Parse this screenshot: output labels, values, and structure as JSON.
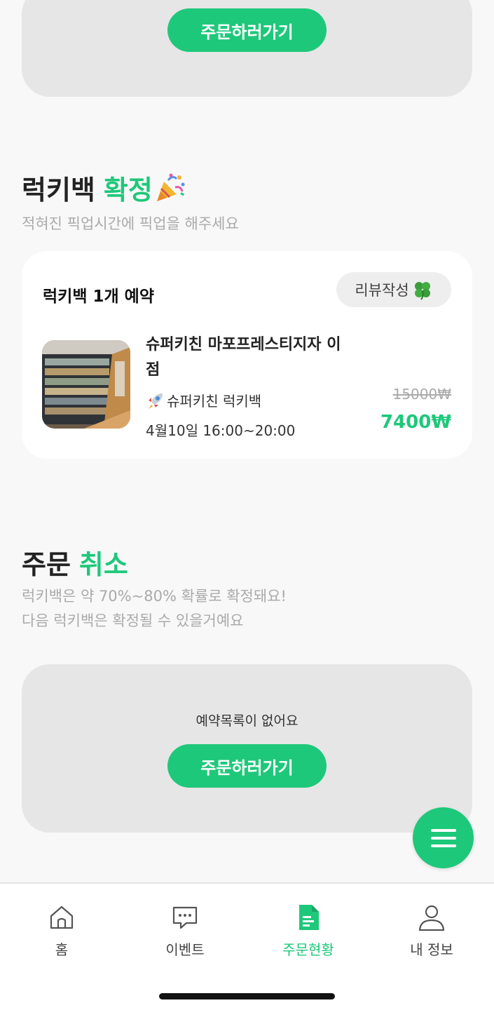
{
  "top_empty": {
    "button_label": "주문하러가기"
  },
  "confirmed": {
    "title_main": "럭키백",
    "title_accent": "확정",
    "subtitle": "적혀진 픽업시간에 픽업을 해주세요",
    "card": {
      "reservation_label": "럭키백 1개 예약",
      "review_button": "리뷰작성",
      "store_name": "슈퍼키친 마포프레스티지자 이점",
      "bag_name": "슈퍼키친 럭키백",
      "pickup_time": "4월10일 16:00~20:00",
      "original_price": "15000₩",
      "sale_price": "7400₩"
    }
  },
  "cancelled": {
    "title_main": "주문",
    "title_accent": "취소",
    "subtitle_line1": "럭키백은 약 70%~80% 확률로 확정돼요!",
    "subtitle_line2": "다음 럭키백은 확정될 수 있을거예요",
    "empty_text": "예약목록이 없어요",
    "button_label": "주문하러가기"
  },
  "nav": {
    "items": [
      {
        "label": "홈",
        "icon": "home-icon"
      },
      {
        "label": "이벤트",
        "icon": "chat-icon"
      },
      {
        "label": "주문현황",
        "icon": "document-icon",
        "active": true
      },
      {
        "label": "내 정보",
        "icon": "user-icon"
      }
    ]
  },
  "colors": {
    "accent": "#1ec87a",
    "empty_box": "#e6e6e6",
    "muted_text": "#aaaaaa"
  }
}
